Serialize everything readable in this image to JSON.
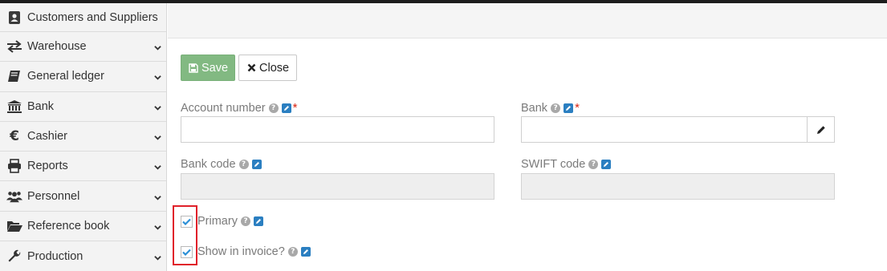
{
  "sidebar": {
    "items": [
      {
        "label": "Customers and Suppliers",
        "icon": "address-book-icon",
        "chevron": false
      },
      {
        "label": "Warehouse",
        "icon": "transfer-arrows-icon",
        "chevron": true
      },
      {
        "label": "General ledger",
        "icon": "book-icon",
        "chevron": true
      },
      {
        "label": "Bank",
        "icon": "bank-building-icon",
        "chevron": true
      },
      {
        "label": "Cashier",
        "icon": "euro-icon",
        "chevron": true
      },
      {
        "label": "Reports",
        "icon": "printer-icon",
        "chevron": true
      },
      {
        "label": "Personnel",
        "icon": "users-icon",
        "chevron": true
      },
      {
        "label": "Reference book",
        "icon": "folder-open-icon",
        "chevron": true
      },
      {
        "label": "Production",
        "icon": "wrench-icon",
        "chevron": true
      }
    ]
  },
  "toolbar": {
    "save_label": "Save",
    "close_label": "Close"
  },
  "form": {
    "account_number": {
      "label": "Account number",
      "required": "*",
      "value": ""
    },
    "bank": {
      "label": "Bank",
      "required": "*",
      "value": ""
    },
    "bank_code": {
      "label": "Bank code",
      "value": ""
    },
    "swift_code": {
      "label": "SWIFT code",
      "value": ""
    },
    "primary": {
      "label": "Primary",
      "checked": true
    },
    "show_in_invoice": {
      "label": "Show in invoice?",
      "checked": true
    }
  },
  "colors": {
    "accent": "#2b7fc1",
    "save_button": "#82b982",
    "required": "#d9230f",
    "highlight": "#e0202a",
    "check": "#2b8fd6"
  }
}
